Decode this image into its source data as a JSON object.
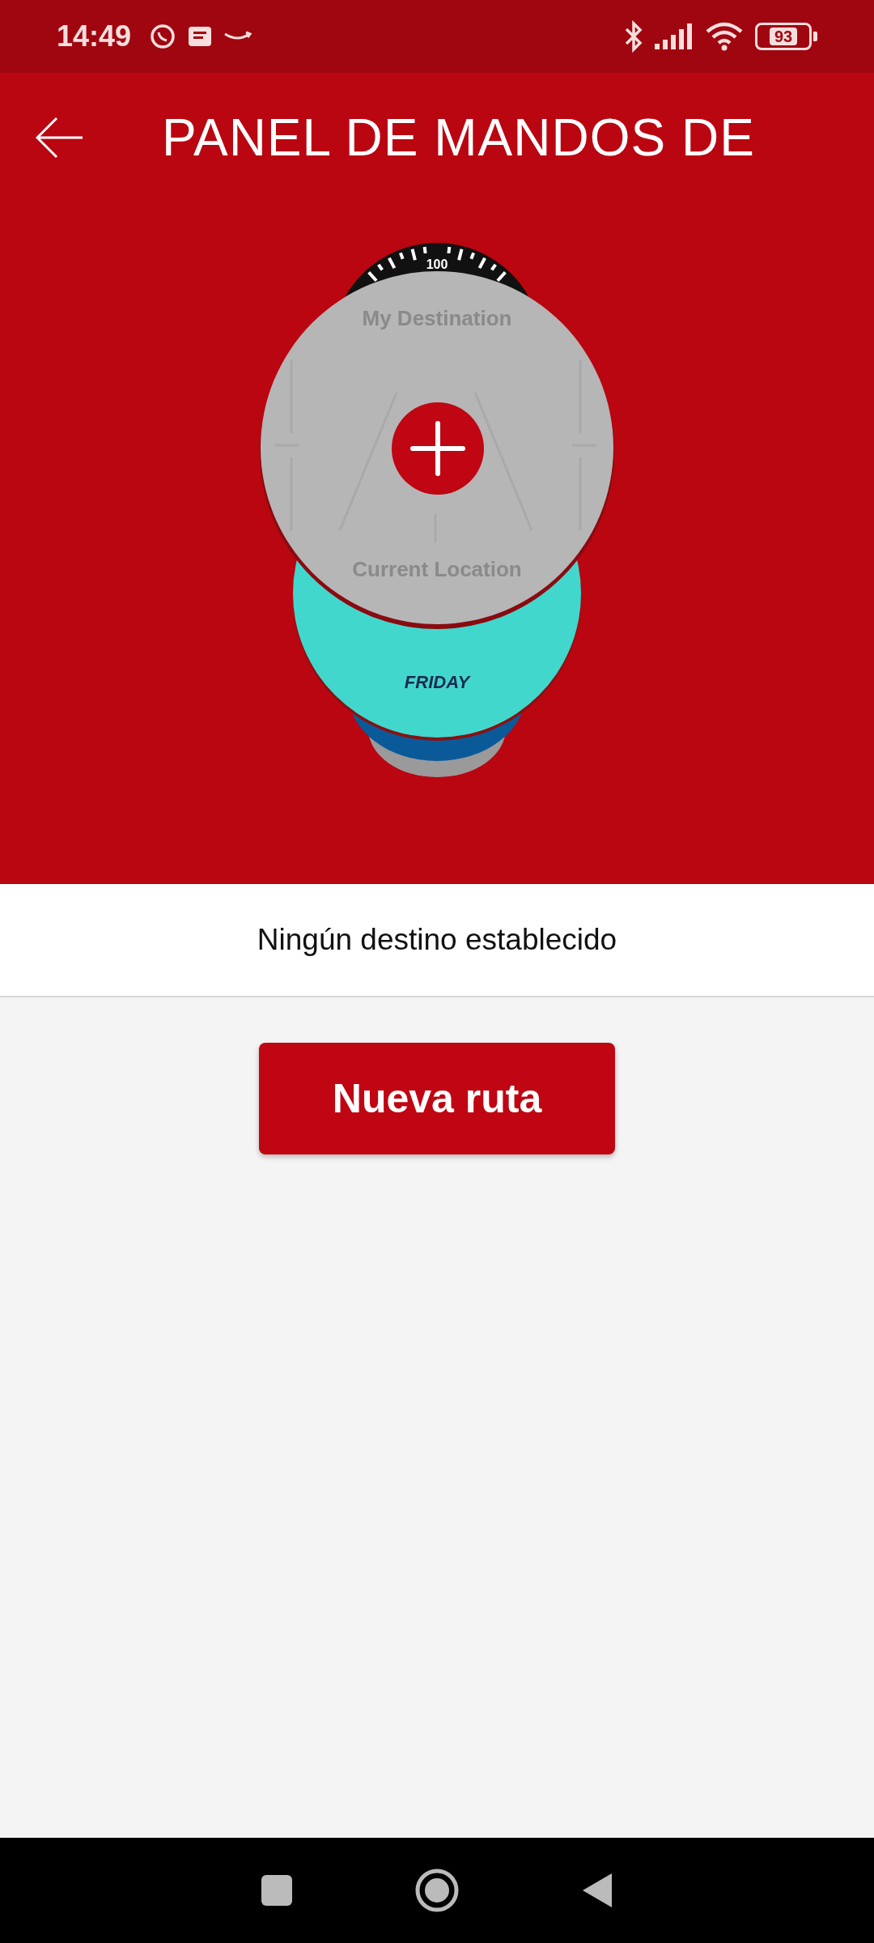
{
  "status_bar": {
    "time": "14:49",
    "battery": "93"
  },
  "app_bar": {
    "title": "PANEL DE MANDOS DE"
  },
  "watch_carousel": {
    "dial_label": "100",
    "destination_label": "My Destination",
    "origin_label": "Current Location",
    "day_label": "FRIDAY"
  },
  "destination_status": "Ningún destino establecido",
  "new_route_button": "Nueva ruta"
}
